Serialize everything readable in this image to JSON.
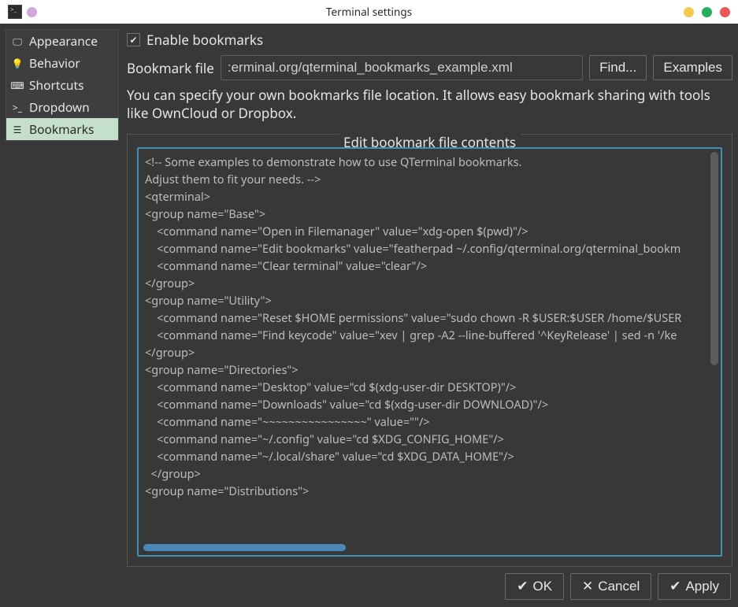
{
  "window": {
    "title": "Terminal settings"
  },
  "traffic": {
    "pin": "#d1a6d8",
    "min": "#f2c94c",
    "max": "#27ae60",
    "close": "#eb5757"
  },
  "sidebar": {
    "items": [
      {
        "label": "Appearance",
        "icon": "monitor-icon"
      },
      {
        "label": "Behavior",
        "icon": "lightbulb-icon"
      },
      {
        "label": "Shortcuts",
        "icon": "keyboard-icon"
      },
      {
        "label": "Dropdown",
        "icon": "terminal-icon"
      },
      {
        "label": "Bookmarks",
        "icon": "bookmark-icon"
      }
    ],
    "selected_index": 4
  },
  "main": {
    "enable_label": "Enable bookmarks",
    "enable_checked": true,
    "file_label": "Bookmark file",
    "file_value": ":erminal.org/qterminal_bookmarks_example.xml",
    "find_label": "Find...",
    "examples_label": "Examples",
    "hint": "You can specify your own bookmarks file location. It allows easy bookmark sharing with tools like OwnCloud or Dropbox.",
    "group_title": "Edit bookmark file contents",
    "editor_lines": [
      "<!-- Some examples to demonstrate how to use QTerminal bookmarks.",
      "Adjust them to fit your needs. -->",
      "<qterminal>",
      "<group name=\"Base\">",
      "    <command name=\"Open in Filemanager\" value=\"xdg-open $(pwd)\"/>",
      "    <command name=\"Edit bookmarks\" value=\"featherpad ~/.config/qterminal.org/qterminal_bookm",
      "    <command name=\"Clear terminal\" value=\"clear\"/>",
      "</group>",
      "<group name=\"Utility\">",
      "    <command name=\"Reset $HOME permissions\" value=\"sudo chown -R $USER:$USER /home/$USER",
      "    <command name=\"Find keycode\" value=\"xev | grep -A2 --line-buffered '^KeyRelease' | sed -n '/ke",
      "</group>",
      "<group name=\"Directories\">",
      "    <command name=\"Desktop\" value=\"cd $(xdg-user-dir DESKTOP)\"/>",
      "    <command name=\"Downloads\" value=\"cd $(xdg-user-dir DOWNLOAD)\"/>",
      "    <command name=\"~~~~~~~~~~~~~~~~\" value=\"\"/>",
      "    <command name=\"~/.config\" value=\"cd $XDG_CONFIG_HOME\"/>",
      "    <command name=\"~/.local/share\" value=\"cd $XDG_DATA_HOME\"/>",
      "  </group>",
      "<group name=\"Distributions\">"
    ]
  },
  "footer": {
    "ok": "OK",
    "cancel": "Cancel",
    "apply": "Apply"
  }
}
